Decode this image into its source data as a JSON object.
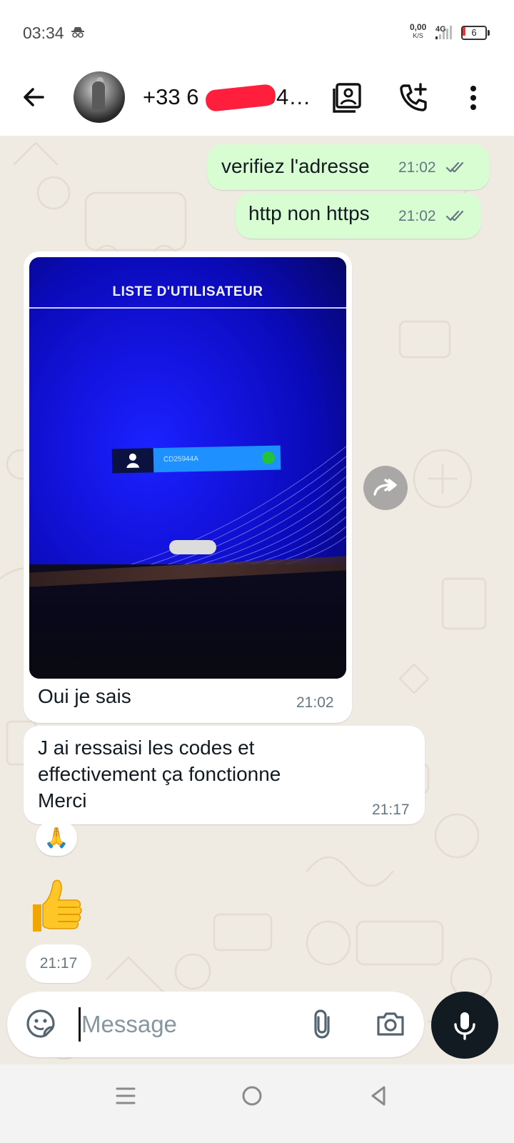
{
  "status_bar": {
    "time": "03:34",
    "net_speed_value": "0,00",
    "net_speed_unit": "K/S",
    "network_type": "4G",
    "battery_level": "6"
  },
  "header": {
    "contact_name": "+33 6 … 12 94…",
    "icons": [
      "back-arrow-icon",
      "contact-card-icon",
      "add-call-icon",
      "more-vert-icon"
    ]
  },
  "messages": [
    {
      "direction": "outgoing",
      "text": "verifiez l'adresse",
      "time": "21:02",
      "status": "read"
    },
    {
      "direction": "outgoing",
      "text": "http non https",
      "time": "21:02",
      "status": "read"
    },
    {
      "direction": "incoming",
      "type": "image",
      "image": {
        "title": "LISTE D'UTILISATEUR",
        "field_value": "CD25944A"
      },
      "caption": "Oui je sais",
      "time": "21:02"
    },
    {
      "direction": "incoming",
      "lines": [
        "J ai ressaisi les codes et",
        "effectivement ça fonctionne",
        "Merci"
      ],
      "time": "21:17",
      "reaction": "🙏"
    },
    {
      "direction": "incoming",
      "type": "emoji",
      "text": "👍",
      "time": "21:17"
    }
  ],
  "composer": {
    "placeholder": "Message",
    "icons": [
      "sticker-icon",
      "attach-icon",
      "camera-icon",
      "mic-icon"
    ]
  },
  "navbar": {
    "icons": [
      "menu-icon",
      "home-icon",
      "back-triangle-icon"
    ]
  },
  "colors": {
    "outgoing_bubble": "#d9fdd3",
    "incoming_bubble": "#ffffff",
    "chat_background": "#efeae2",
    "read_ticks": "#667781",
    "redaction": "#ff1f3d"
  }
}
